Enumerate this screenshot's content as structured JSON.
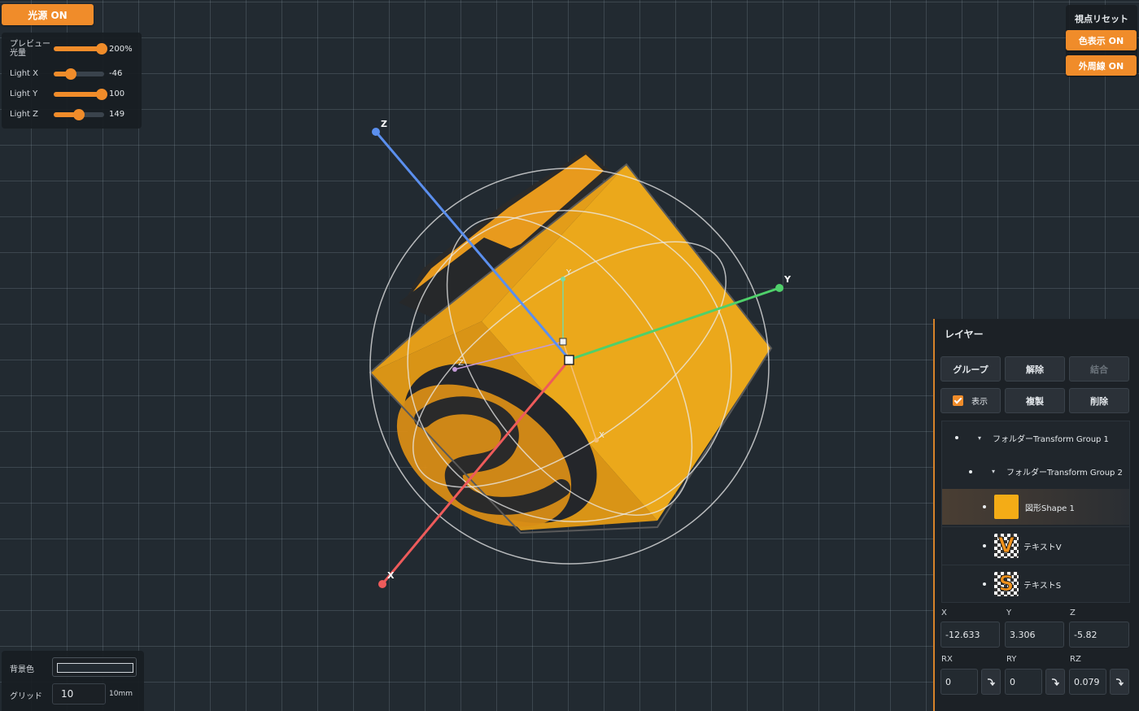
{
  "toolbar": {
    "light_toggle": "光源 ON",
    "view_reset": "視点リセット",
    "color_display": "色表示 ON",
    "outline": "外周線 ON"
  },
  "light_panel": {
    "rows": [
      {
        "label": "プレビュー光量",
        "value": "200%",
        "fraction": 1.0
      },
      {
        "label": "Light X",
        "value": "-46",
        "fraction": 0.33
      },
      {
        "label": "Light Y",
        "value": "100",
        "fraction": 1.0
      },
      {
        "label": "Light Z",
        "value": "149",
        "fraction": 0.5
      }
    ]
  },
  "scene": {
    "axis_labels": {
      "x": "X",
      "y": "Y",
      "z": "Z"
    },
    "axis_colors": {
      "x": "#ee5b5b",
      "y": "#4fd06a",
      "z": "#5b8fee"
    },
    "shape_color": "#f0a21b"
  },
  "bottom_panel": {
    "bg_label": "背景色",
    "grid_label": "グリッド",
    "grid_value": "10",
    "grid_unit": "10mm"
  },
  "layers": {
    "title": "レイヤー",
    "buttons": {
      "group": "グループ",
      "ungroup": "解除",
      "merge": "結合",
      "show": "表示",
      "duplicate": "複製",
      "delete": "削除"
    },
    "items": [
      {
        "name": "フォルダーTransform Group 1"
      },
      {
        "name": "フォルダーTransform Group 2"
      },
      {
        "name": "図形Shape 1"
      },
      {
        "name": "テキストV",
        "glyph": "V"
      },
      {
        "name": "テキストS",
        "glyph": "S"
      }
    ],
    "coords": {
      "labels": {
        "x": "X",
        "y": "Y",
        "z": "Z",
        "rx": "RX",
        "ry": "RY",
        "rz": "RZ"
      },
      "x": "-12.633",
      "y": "3.306",
      "z": "-5.82",
      "rx": "0",
      "ry": "0",
      "rz": "0.079"
    }
  }
}
